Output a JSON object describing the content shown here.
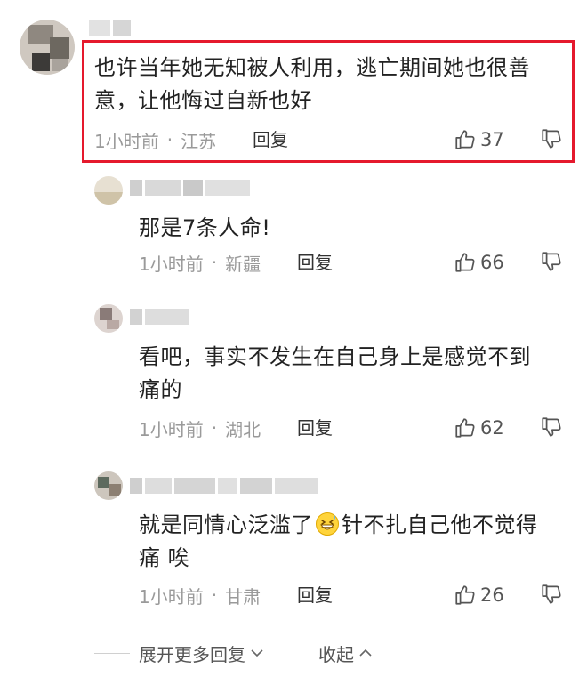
{
  "comments": [
    {
      "text_line1": "也许当年她无知被人利用，逃亡期间她也很善",
      "text_line2": "意，让他悔过自新也好",
      "time": "1小时前",
      "location": "江苏",
      "reply_label": "回复",
      "likes": "37"
    }
  ],
  "replies": [
    {
      "text_line1": "那是7条人命!",
      "time": "1小时前",
      "location": "新疆",
      "reply_label": "回复",
      "likes": "66"
    },
    {
      "text_line1": "看吧，事实不发生在自己身上是感觉不到",
      "text_line2": "痛的",
      "time": "1小时前",
      "location": "湖北",
      "reply_label": "回复",
      "likes": "62"
    },
    {
      "text_pre": "就是同情心泛滥了",
      "text_post": "针不扎自己他不觉得",
      "text_line2": "痛 唉",
      "time": "1小时前",
      "location": "甘肃",
      "reply_label": "回复",
      "likes": "26"
    }
  ],
  "footer": {
    "expand_label": "展开更多回复",
    "collapse_label": "收起"
  },
  "colors": {
    "highlight": "#e5192d",
    "meta": "#9a9a9a"
  },
  "icons": [
    "thumbs-up-icon",
    "thumbs-down-icon",
    "grinning-sweat-emoji",
    "chevron-down-icon",
    "chevron-up-icon"
  ]
}
